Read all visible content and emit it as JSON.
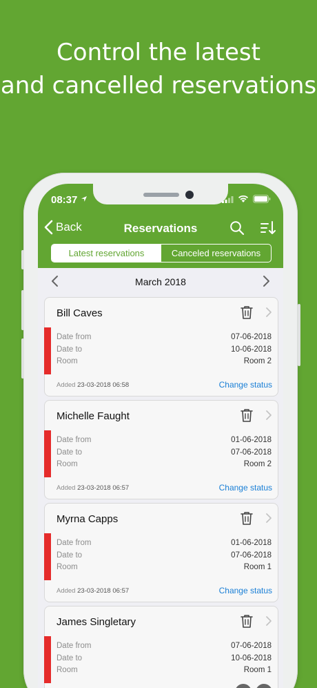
{
  "headline": {
    "line1": "Control the latest",
    "line2": "and cancelled reservations"
  },
  "status_bar": {
    "time": "08:37"
  },
  "navbar": {
    "back_label": "Back",
    "title": "Reservations"
  },
  "segments": {
    "latest": "Latest reservations",
    "canceled": "Canceled reservations",
    "selected": "latest"
  },
  "month": {
    "label": "March 2018"
  },
  "labels": {
    "date_from": "Date from",
    "date_to": "Date to",
    "room": "Room",
    "added": "Added",
    "change_status": "Change status"
  },
  "reservations": [
    {
      "name": "Bill Caves",
      "date_from": "07-06-2018",
      "date_to": "10-06-2018",
      "room": "Room 2",
      "added": "23-03-2018 06:58"
    },
    {
      "name": "Michelle Faught",
      "date_from": "01-06-2018",
      "date_to": "07-06-2018",
      "room": "Room 2",
      "added": "23-03-2018 06:57"
    },
    {
      "name": "Myrna Capps",
      "date_from": "01-06-2018",
      "date_to": "07-06-2018",
      "room": "Room 1",
      "added": "23-03-2018 06:57"
    },
    {
      "name": "James Singletary",
      "date_from": "07-06-2018",
      "date_to": "10-06-2018",
      "room": "Room 1"
    }
  ],
  "colors": {
    "brand_green": "#62a632",
    "status_red": "#e52b2b",
    "link_blue": "#1a7fd6"
  }
}
